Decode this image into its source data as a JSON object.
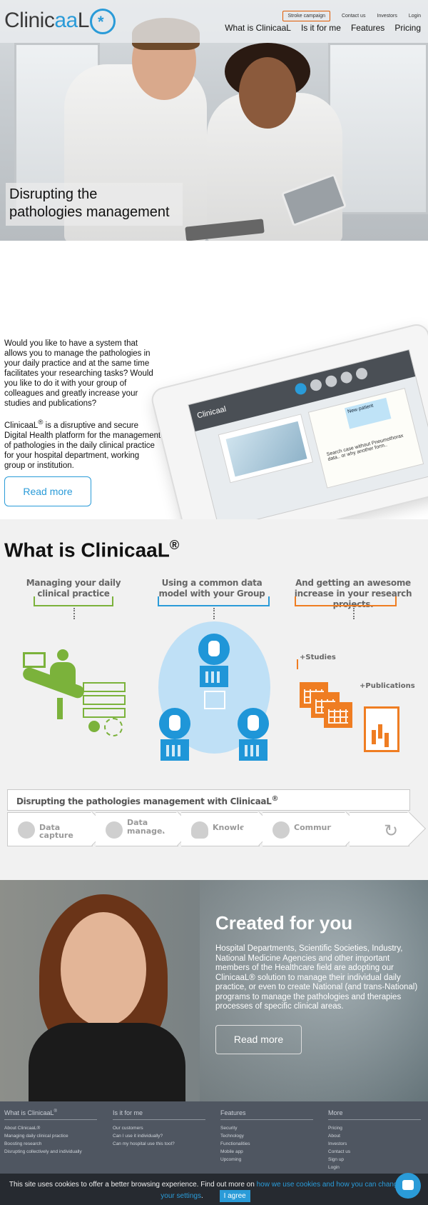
{
  "header": {
    "logo_text_a": "Clinic",
    "logo_text_b": "aa",
    "logo_text_c": "L",
    "logo_icon": "asterisk-icon",
    "util_links": [
      "Stroke campaign",
      "Contact us",
      "Investors",
      "Login"
    ],
    "nav": [
      "What is ClinicaaL",
      "Is it for me",
      "Features",
      "Pricing"
    ]
  },
  "hero": {
    "caption_line1": "Disrupting the",
    "caption_line2": "pathologies management"
  },
  "intro": {
    "paragraph1": "Would you like to have a system that allows you to manage the pathologies in your daily practice and at the same time facilitates your researching tasks? Would you like to do it with your group of colleagues and greatly increase your studies and publications?",
    "paragraph2_brand": "ClinicaaL",
    "paragraph2_reg": "®",
    "paragraph2_rest": " is a disruptive and secure Digital Health platform for the management of pathologies in the daily clinical practice for your hospital department, working group or institution.",
    "read_more": "Read more",
    "tablet_logo": "Clinicaal",
    "tablet_note": "New patient",
    "tablet_scribble": "Search case without Pneumothorax data.. or why another form.."
  },
  "whatis": {
    "title": "What is ClinicaaL",
    "title_reg": "®",
    "col1": "Managing your daily clinical practice",
    "col2": "Using a common data model with your Group",
    "col3": "And getting an awesome increase in your research projects.",
    "studies": "+Studies",
    "publications": "+Publications",
    "process_title": "Disrupting the pathologies management with ClinicaaL",
    "process_title_reg": "®",
    "steps": [
      "Data capture",
      "Data management",
      "Knowledge",
      "Community"
    ],
    "step_data_mgmt_line1": "Data",
    "step_data_mgmt_line2": "management",
    "refresh_icon": "↻"
  },
  "created": {
    "title": "Created for you",
    "text": "Hospital Departments, Scientific Societies, Industry, National Medicine Agencies and other important members of the Healthcare field are adopting our ClinicaaL® solution to manage their individual daily practice, or even to create National (and trans-National) programs to manage the pathologies and therapies processes of specific clinical areas.",
    "read_more": "Read more"
  },
  "footer": {
    "col1_title": "What is ClinicaaL",
    "col1_title_reg": "®",
    "col1_items": [
      "About ClinicaaL®",
      "Managing daily clinical practice",
      "Boosting research",
      "Disrupting collectively and individually"
    ],
    "col2_title": "Is it for me",
    "col2_items": [
      "Our customers",
      "Can I use it individually?",
      "Can my hospital use this tool?"
    ],
    "col3_title": "Features",
    "col3_items": [
      "Security",
      "Technology",
      "Functionalities",
      "Mobile app",
      "Upcoming"
    ],
    "col4_title": "More",
    "col4_items": [
      "Pricing",
      "About",
      "Investors",
      "Contact us",
      "Sign up",
      "Login"
    ]
  },
  "cookie": {
    "text": "This site uses cookies to offer a better browsing experience. Find out more on ",
    "link": "how we use cookies and how you can change your settings",
    "suffix": ".",
    "agree": "I agree"
  },
  "colors": {
    "brand_blue": "#2a9bd8",
    "green": "#7bb23b",
    "orange": "#ef7d22",
    "footer_bg": "#4f5661"
  }
}
